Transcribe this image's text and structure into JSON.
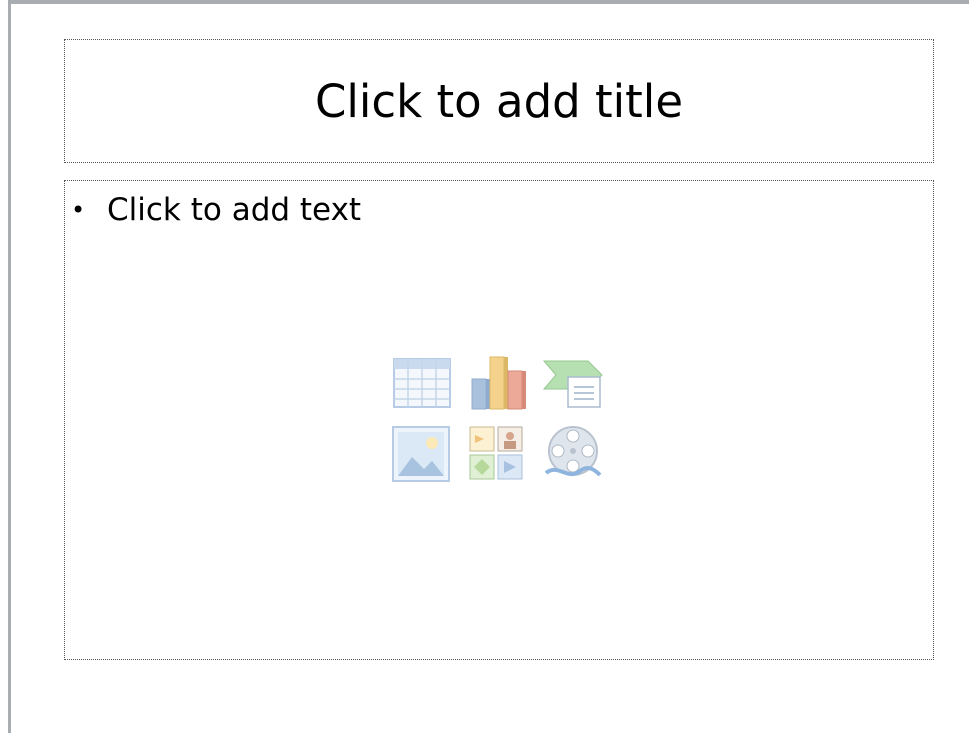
{
  "slide": {
    "title_placeholder": "Click to add title",
    "bullet_char": "•",
    "body_placeholder": "Click to add text",
    "insert_icons": [
      "table-icon",
      "chart-icon",
      "smartart-icon",
      "picture-icon",
      "clip-art-icon",
      "media-clip-icon"
    ]
  },
  "colors": {
    "frame": "#a9acb0",
    "placeholder_border": "#555555",
    "icon_blue": "#aec8e6",
    "icon_green": "#9fd4a0",
    "icon_orange": "#f0a98a"
  }
}
